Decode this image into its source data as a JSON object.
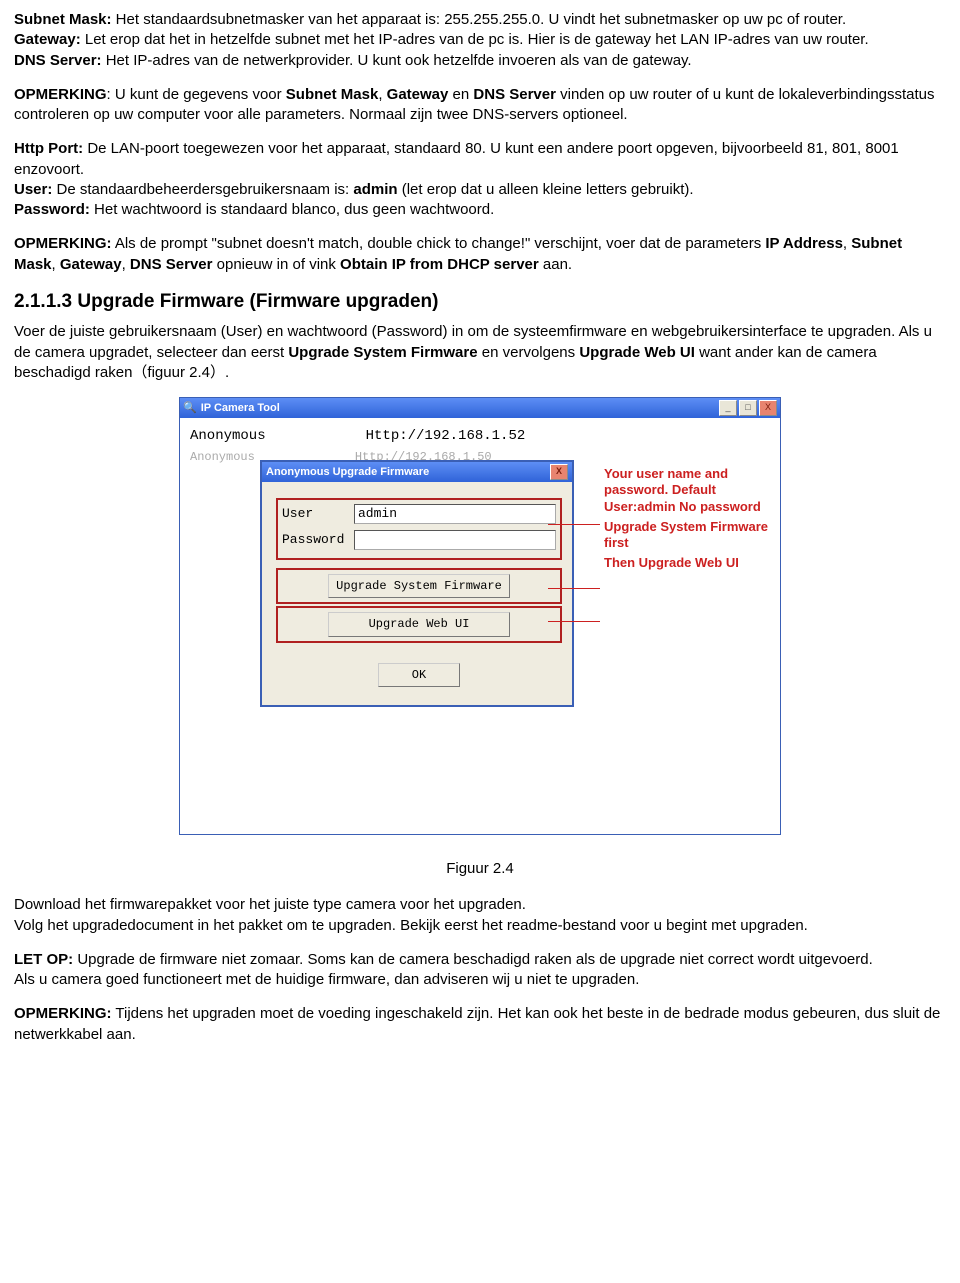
{
  "p1a_label": "Subnet Mask:",
  "p1a": " Het standaardsubnetmasker van het apparaat is: 255.255.255.0. U vindt het subnetmasker op uw pc of router.",
  "p1b_label": "Gateway:",
  "p1b": " Let erop dat het in hetzelfde subnet met het IP-adres van de pc is. Hier is de gateway het LAN IP-adres van uw router.",
  "p1c_label": "DNS Server:",
  "p1c": " Het IP-adres van de netwerkprovider. U kunt ook hetzelfde invoeren als van de gateway.",
  "p2_label": "OPMERKING",
  "p2a": ": U kunt de gegevens voor ",
  "p2b1": "Subnet Mask",
  "p2b2": ", ",
  "p2c1": "Gateway",
  "p2c2": " en ",
  "p2d1": "DNS Server",
  "p2d2": " vinden op uw router of u kunt de lokaleverbindingsstatus controleren op uw computer voor alle parameters. Normaal zijn twee DNS-servers optioneel.",
  "p3a_label": "Http Port:",
  "p3a": " De LAN-poort toegewezen voor het apparaat, standaard 80. U kunt een andere poort opgeven, bijvoorbeeld 81, 801, 8001 enzovoort.",
  "p3b_label": "User:",
  "p3b": " De standaardbeheerdersgebruikersnaam is: ",
  "p3b_bold": "admin",
  "p3b_after": " (let erop dat u alleen kleine letters gebruikt).",
  "p3c_label": "Password:",
  "p3c": " Het wachtwoord is standaard blanco, dus geen wachtwoord.",
  "p4_label": "OPMERKING:",
  "p4a": " Als de prompt \"subnet doesn't match, double chick to change!\" verschijnt, voer dat de parameters ",
  "p4b1": "IP Address",
  "p4b2": ", ",
  "p4c1": "Subnet Mask",
  "p4c2": ", ",
  "p4d1": "Gateway",
  "p4d2": ", ",
  "p4e1": "DNS Server",
  "p4e2": " opnieuw in of vink ",
  "p4f1": "Obtain IP from DHCP server",
  "p4f2": " aan.",
  "h3": "2.1.1.3 Upgrade Firmware (Firmware upgraden)",
  "p5a": "Voer de juiste gebruikersnaam (User) en wachtwoord (Password) in om de systeemfirmware en webgebruikersinterface te upgraden. Als u de camera upgradet, selecteer dan eerst ",
  "p5b1": "Upgrade System Firmware",
  "p5b2": " en vervolgens ",
  "p5c1": "Upgrade Web UI",
  "p5c2": " want ander kan de camera beschadigd raken（figuur 2.4）.",
  "dialog": {
    "tool_title": "IP Camera Tool",
    "list_name": "Anonymous",
    "list_addr": "Http://192.168.1.52",
    "list_name2": "Anonymous",
    "list_addr2": "Http://192.168.1.50",
    "sub_title": "Anonymous Upgrade Firmware",
    "user_label": "User",
    "user_value": "admin",
    "pass_label": "Password",
    "btn_sys": "Upgrade System Firmware",
    "btn_web": "Upgrade Web UI",
    "btn_ok": "OK",
    "ann1": "Your user name and password. Default User:admin No password",
    "ann2": "Upgrade System Firmware first",
    "ann3": "Then Upgrade Web UI",
    "min": "_",
    "max": "□",
    "close": "X"
  },
  "figcaption": "Figuur 2.4",
  "p6a": "Download het firmwarepakket voor het juiste type camera voor het upgraden.",
  "p6b": "Volg het upgradedocument in het pakket om te upgraden. Bekijk eerst het readme-bestand voor u begint met upgraden.",
  "p7_label": "LET OP:",
  "p7a": " Upgrade de firmware niet zomaar. Soms kan de camera beschadigd raken als de upgrade niet correct wordt uitgevoerd.",
  "p7b": "Als u camera goed functioneert met de huidige firmware, dan adviseren wij u niet te upgraden.",
  "p8_label": "OPMERKING:",
  "p8": " Tijdens het upgraden moet de voeding ingeschakeld zijn. Het kan ook het beste in de bedrade modus gebeuren, dus sluit de netwerkkabel aan."
}
